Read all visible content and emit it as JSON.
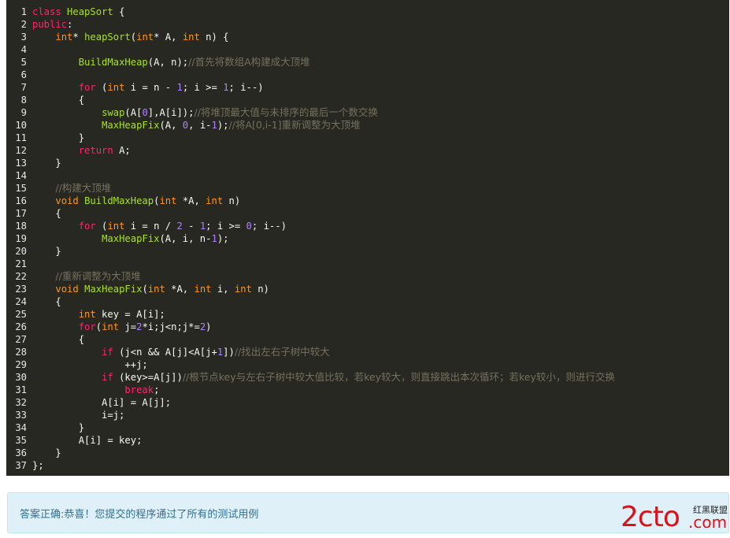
{
  "code_lines": [
    {
      "n": "1",
      "tokens": [
        [
          "kw",
          "class"
        ],
        [
          "op",
          " "
        ],
        [
          "fn",
          "HeapSort"
        ],
        [
          "op",
          " {"
        ]
      ]
    },
    {
      "n": "2",
      "tokens": [
        [
          "kw",
          "public"
        ],
        [
          "op",
          ":"
        ]
      ]
    },
    {
      "n": "3",
      "tokens": [
        [
          "op",
          "    "
        ],
        [
          "ty2",
          "int"
        ],
        [
          "op",
          "* "
        ],
        [
          "fn",
          "heapSort"
        ],
        [
          "op",
          "("
        ],
        [
          "ty2",
          "int"
        ],
        [
          "op",
          "* A, "
        ],
        [
          "ty2",
          "int"
        ],
        [
          "op",
          " n) {"
        ]
      ]
    },
    {
      "n": "4",
      "tokens": []
    },
    {
      "n": "5",
      "tokens": [
        [
          "op",
          "        "
        ],
        [
          "fn",
          "BuildMaxHeap"
        ],
        [
          "op",
          "(A, n);"
        ],
        [
          "cm",
          "//首先将数组A构建成大顶堆"
        ]
      ]
    },
    {
      "n": "6",
      "tokens": []
    },
    {
      "n": "7",
      "tokens": [
        [
          "op",
          "        "
        ],
        [
          "kw",
          "for"
        ],
        [
          "op",
          " ("
        ],
        [
          "ty2",
          "int"
        ],
        [
          "op",
          " i = n - "
        ],
        [
          "num",
          "1"
        ],
        [
          "op",
          "; i >= "
        ],
        [
          "num",
          "1"
        ],
        [
          "op",
          "; i--)"
        ]
      ]
    },
    {
      "n": "8",
      "tokens": [
        [
          "op",
          "        {"
        ]
      ]
    },
    {
      "n": "9",
      "tokens": [
        [
          "op",
          "            "
        ],
        [
          "fn",
          "swap"
        ],
        [
          "op",
          "(A["
        ],
        [
          "num",
          "0"
        ],
        [
          "op",
          "],A[i]);"
        ],
        [
          "cm",
          "//将堆顶最大值与未排序的最后一个数交换"
        ]
      ]
    },
    {
      "n": "10",
      "tokens": [
        [
          "op",
          "            "
        ],
        [
          "fn",
          "MaxHeapFix"
        ],
        [
          "op",
          "(A, "
        ],
        [
          "num",
          "0"
        ],
        [
          "op",
          ", i-"
        ],
        [
          "num",
          "1"
        ],
        [
          "op",
          ");"
        ],
        [
          "cm",
          "//将A[0,i-1]重新调整为大顶堆"
        ]
      ]
    },
    {
      "n": "11",
      "tokens": [
        [
          "op",
          "        }"
        ]
      ]
    },
    {
      "n": "12",
      "tokens": [
        [
          "op",
          "        "
        ],
        [
          "kw",
          "return"
        ],
        [
          "op",
          " A;"
        ]
      ]
    },
    {
      "n": "13",
      "tokens": [
        [
          "op",
          "    }"
        ]
      ]
    },
    {
      "n": "14",
      "tokens": []
    },
    {
      "n": "15",
      "tokens": [
        [
          "op",
          "    "
        ],
        [
          "cm",
          "//构建大顶堆"
        ]
      ]
    },
    {
      "n": "16",
      "tokens": [
        [
          "op",
          "    "
        ],
        [
          "ty2",
          "void"
        ],
        [
          "op",
          " "
        ],
        [
          "fn",
          "BuildMaxHeap"
        ],
        [
          "op",
          "("
        ],
        [
          "ty2",
          "int"
        ],
        [
          "op",
          " *A, "
        ],
        [
          "ty2",
          "int"
        ],
        [
          "op",
          " n)"
        ]
      ]
    },
    {
      "n": "17",
      "tokens": [
        [
          "op",
          "    {"
        ]
      ]
    },
    {
      "n": "18",
      "tokens": [
        [
          "op",
          "        "
        ],
        [
          "kw",
          "for"
        ],
        [
          "op",
          " ("
        ],
        [
          "ty2",
          "int"
        ],
        [
          "op",
          " i = n / "
        ],
        [
          "num",
          "2"
        ],
        [
          "op",
          " - "
        ],
        [
          "num",
          "1"
        ],
        [
          "op",
          "; i >= "
        ],
        [
          "num",
          "0"
        ],
        [
          "op",
          "; i--)"
        ]
      ]
    },
    {
      "n": "19",
      "tokens": [
        [
          "op",
          "            "
        ],
        [
          "fn",
          "MaxHeapFix"
        ],
        [
          "op",
          "(A, i, n-"
        ],
        [
          "num",
          "1"
        ],
        [
          "op",
          ");"
        ]
      ]
    },
    {
      "n": "20",
      "tokens": [
        [
          "op",
          "    }"
        ]
      ]
    },
    {
      "n": "21",
      "tokens": []
    },
    {
      "n": "22",
      "tokens": [
        [
          "op",
          "    "
        ],
        [
          "cm",
          "//重新调整为大顶堆"
        ]
      ]
    },
    {
      "n": "23",
      "tokens": [
        [
          "op",
          "    "
        ],
        [
          "ty2",
          "void"
        ],
        [
          "op",
          " "
        ],
        [
          "fn",
          "MaxHeapFix"
        ],
        [
          "op",
          "("
        ],
        [
          "ty2",
          "int"
        ],
        [
          "op",
          " *A, "
        ],
        [
          "ty2",
          "int"
        ],
        [
          "op",
          " i, "
        ],
        [
          "ty2",
          "int"
        ],
        [
          "op",
          " n)"
        ]
      ]
    },
    {
      "n": "24",
      "tokens": [
        [
          "op",
          "    {"
        ]
      ]
    },
    {
      "n": "25",
      "tokens": [
        [
          "op",
          "        "
        ],
        [
          "ty2",
          "int"
        ],
        [
          "op",
          " key = A[i];"
        ]
      ]
    },
    {
      "n": "26",
      "tokens": [
        [
          "op",
          "        "
        ],
        [
          "kw",
          "for"
        ],
        [
          "op",
          "("
        ],
        [
          "ty2",
          "int"
        ],
        [
          "op",
          " j="
        ],
        [
          "num",
          "2"
        ],
        [
          "op",
          "*i;j<n;j*="
        ],
        [
          "num",
          "2"
        ],
        [
          "op",
          ")"
        ]
      ]
    },
    {
      "n": "27",
      "tokens": [
        [
          "op",
          "        {"
        ]
      ]
    },
    {
      "n": "28",
      "tokens": [
        [
          "op",
          "            "
        ],
        [
          "kw",
          "if"
        ],
        [
          "op",
          " (j<n && A[j]<A[j+"
        ],
        [
          "num",
          "1"
        ],
        [
          "op",
          "])"
        ],
        [
          "cm",
          "//找出左右子树中较大"
        ]
      ]
    },
    {
      "n": "29",
      "tokens": [
        [
          "op",
          "                ++j;"
        ]
      ]
    },
    {
      "n": "30",
      "tokens": [
        [
          "op",
          "            "
        ],
        [
          "kw",
          "if"
        ],
        [
          "op",
          " (key>=A[j])"
        ],
        [
          "cm",
          "//根节点key与左右子树中较大值比较，若key较大，则直接跳出本次循环；若key较小，则进行交换"
        ]
      ]
    },
    {
      "n": "31",
      "tokens": [
        [
          "op",
          "                "
        ],
        [
          "kw",
          "break"
        ],
        [
          "op",
          ";"
        ]
      ]
    },
    {
      "n": "32",
      "tokens": [
        [
          "op",
          "            A[i] = A[j];"
        ]
      ]
    },
    {
      "n": "33",
      "tokens": [
        [
          "op",
          "            i=j;"
        ]
      ]
    },
    {
      "n": "34",
      "tokens": [
        [
          "op",
          "        }"
        ]
      ]
    },
    {
      "n": "35",
      "tokens": [
        [
          "op",
          "        A[i] = key;"
        ]
      ]
    },
    {
      "n": "36",
      "tokens": [
        [
          "op",
          "    }"
        ]
      ]
    },
    {
      "n": "37",
      "tokens": [
        [
          "op",
          "};"
        ]
      ]
    }
  ],
  "result": {
    "message": "答案正确:恭喜！您提交的程序通过了所有的测试用例"
  },
  "logo": {
    "main": "2cto",
    "suffix": ".com",
    "tagline": "红黑联盟",
    "color": "#d9121b"
  }
}
